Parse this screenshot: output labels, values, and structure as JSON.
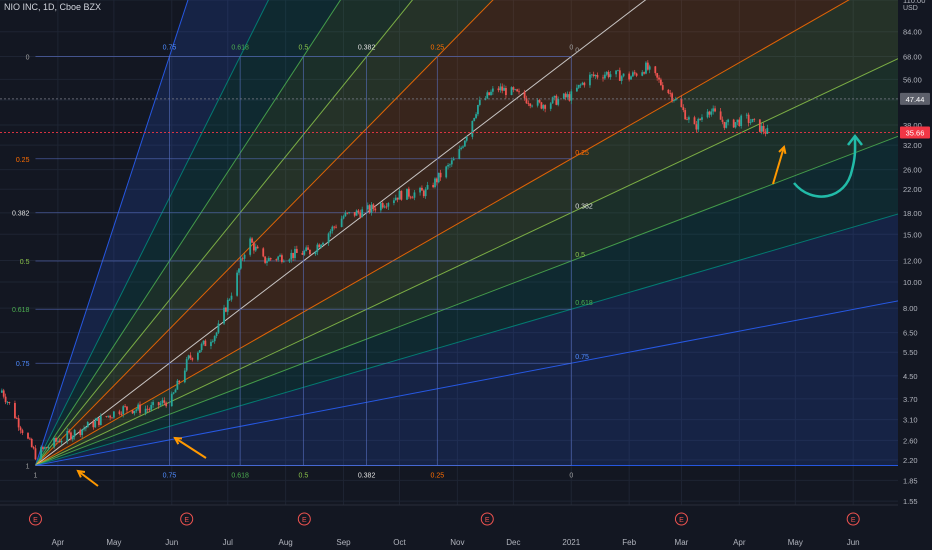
{
  "header": {
    "symbol": "NIO INC, 1D, Cboe BZX"
  },
  "colors": {
    "background": "#131722",
    "grid": "#1e2433",
    "up_candle": "#26a69a",
    "down_candle": "#ef5350",
    "price_line": "#f23645",
    "level_line": "#5b74c9",
    "fan_blue": "#2962ff",
    "fan_teal": "#00897b",
    "fan_green": "#4caf50",
    "fan_lime": "#8bc34a",
    "fan_orange": "#ff6d00",
    "fan_white": "#e0e0e0",
    "arrow_orange": "#ff9800",
    "arrow_teal": "#22bba8",
    "marker_red": "#ef5350"
  },
  "chart_data": {
    "type": "candlestick",
    "title": "NIO INC, 1D, Cboe BZX",
    "y_scale": "log",
    "y_currency": "USD",
    "ylim": [
      1.5,
      110
    ],
    "x_range": [
      "2020-03-01",
      "2021-06-25"
    ],
    "x_ticks": [
      {
        "label": "Apr",
        "date": "2020-04-01"
      },
      {
        "label": "May",
        "date": "2020-05-01"
      },
      {
        "label": "Jun",
        "date": "2020-06-01"
      },
      {
        "label": "Jul",
        "date": "2020-07-01"
      },
      {
        "label": "Aug",
        "date": "2020-08-01"
      },
      {
        "label": "Sep",
        "date": "2020-09-01"
      },
      {
        "label": "Oct",
        "date": "2020-10-01"
      },
      {
        "label": "Nov",
        "date": "2020-11-01"
      },
      {
        "label": "Dec",
        "date": "2020-12-01"
      },
      {
        "label": "2021",
        "date": "2021-01-01"
      },
      {
        "label": "Feb",
        "date": "2021-02-01"
      },
      {
        "label": "Mar",
        "date": "2021-03-01"
      },
      {
        "label": "Apr",
        "date": "2021-04-01"
      },
      {
        "label": "May",
        "date": "2021-05-01"
      },
      {
        "label": "Jun",
        "date": "2021-06-01"
      }
    ],
    "y_ticks": [
      "110.00",
      "84.00",
      "68.00",
      "56.00",
      "47.00",
      "38.00",
      "32.00",
      "26.00",
      "22.00",
      "18.00",
      "15.00",
      "12.00",
      "10.00",
      "8.00",
      "6.50",
      "5.50",
      "4.50",
      "3.70",
      "3.10",
      "2.60",
      "2.20",
      "1.85",
      "1.55"
    ],
    "y_tick_values": [
      110,
      84,
      68,
      56,
      47,
      38,
      32,
      26,
      22,
      18,
      15,
      12,
      10,
      8,
      6.5,
      5.5,
      4.5,
      3.7,
      3.1,
      2.6,
      2.2,
      1.85,
      1.55
    ],
    "price_tags": [
      {
        "label": "47.44",
        "value": 47.44,
        "color": "#5d606b"
      },
      {
        "label": "35.66",
        "value": 35.66,
        "color": "#f23645"
      }
    ],
    "series": [
      {
        "date": "2020-03-20",
        "close": 2.3
      },
      {
        "date": "2020-04-01",
        "close": 2.6
      },
      {
        "date": "2020-04-20",
        "close": 3.0
      },
      {
        "date": "2020-05-05",
        "close": 3.4
      },
      {
        "date": "2020-05-20",
        "close": 3.4
      },
      {
        "date": "2020-06-01",
        "close": 3.7
      },
      {
        "date": "2020-06-10",
        "close": 5.2
      },
      {
        "date": "2020-06-25",
        "close": 6.5
      },
      {
        "date": "2020-07-05",
        "close": 10.0
      },
      {
        "date": "2020-07-12",
        "close": 14.5
      },
      {
        "date": "2020-07-20",
        "close": 12.0
      },
      {
        "date": "2020-08-01",
        "close": 12.5
      },
      {
        "date": "2020-08-15",
        "close": 13.0
      },
      {
        "date": "2020-09-01",
        "close": 17.5
      },
      {
        "date": "2020-09-15",
        "close": 18.5
      },
      {
        "date": "2020-10-01",
        "close": 21.0
      },
      {
        "date": "2020-10-15",
        "close": 21.5
      },
      {
        "date": "2020-11-01",
        "close": 29.0
      },
      {
        "date": "2020-11-12",
        "close": 45.0
      },
      {
        "date": "2020-11-22",
        "close": 52.0
      },
      {
        "date": "2020-12-01",
        "close": 50.0
      },
      {
        "date": "2020-12-15",
        "close": 45.0
      },
      {
        "date": "2021-01-01",
        "close": 48.7
      },
      {
        "date": "2021-01-10",
        "close": 57.0
      },
      {
        "date": "2021-01-20",
        "close": 59.0
      },
      {
        "date": "2021-02-01",
        "close": 57.0
      },
      {
        "date": "2021-02-10",
        "close": 62.0
      },
      {
        "date": "2021-02-25",
        "close": 48.0
      },
      {
        "date": "2021-03-08",
        "close": 37.0
      },
      {
        "date": "2021-03-15",
        "close": 44.0
      },
      {
        "date": "2021-03-25",
        "close": 38.0
      },
      {
        "date": "2021-04-05",
        "close": 40.0
      },
      {
        "date": "2021-04-16",
        "close": 35.66
      }
    ],
    "fib_fan": {
      "origin": {
        "date": "2020-03-20",
        "price": 2.1
      },
      "levels": [
        "0",
        "0.25",
        "0.382",
        "0.5",
        "0.618",
        "0.75",
        "1"
      ],
      "top_labels": [
        "0.75",
        "0.618",
        "0.5",
        "0.382",
        "0.25",
        "0"
      ],
      "bottom_labels": [
        "0.75",
        "0.618",
        "0.5",
        "0.382",
        "0.25",
        "0"
      ],
      "right_labels": [
        "0",
        "0.25",
        "0.382",
        "0.5",
        "0.618",
        "0.75"
      ],
      "left_labels": [
        "0",
        "0.25",
        "0.382",
        "0.5",
        "0.618",
        "0.75",
        "1"
      ],
      "bottom_left_label": "1"
    },
    "event_markers": [
      {
        "label": "E",
        "date": "2020-03-20"
      },
      {
        "label": "E",
        "date": "2020-06-09"
      },
      {
        "label": "E",
        "date": "2020-08-11"
      },
      {
        "label": "E",
        "date": "2020-11-17"
      },
      {
        "label": "E",
        "date": "2021-03-01"
      },
      {
        "label": "E",
        "date": "2021-06-01"
      }
    ]
  }
}
